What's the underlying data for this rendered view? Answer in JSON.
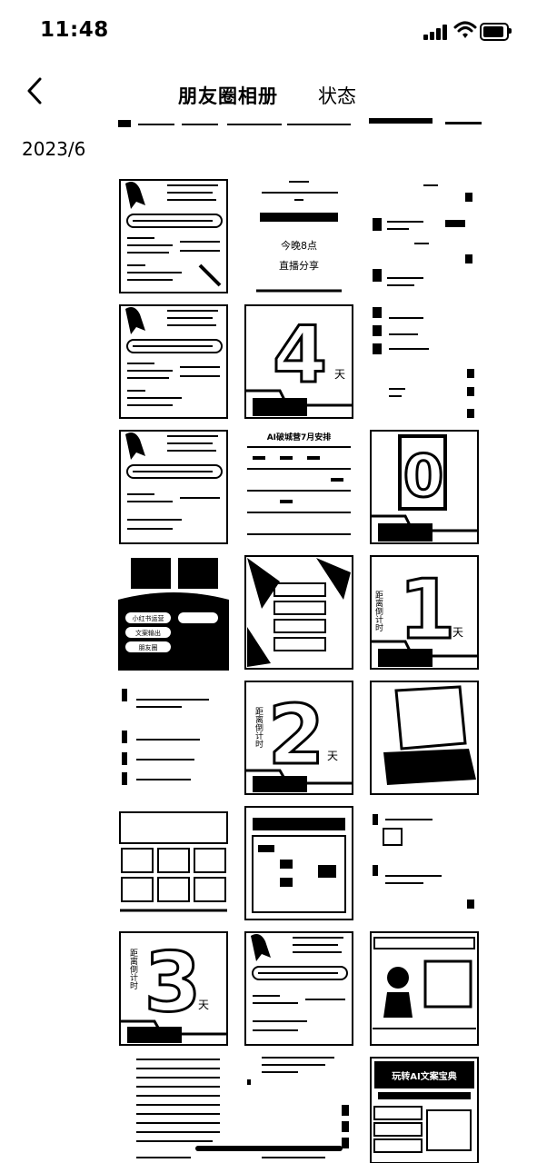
{
  "status_bar": {
    "time": "11:48"
  },
  "nav": {
    "album_tab": "朋友圈相册",
    "status_tab": "状态"
  },
  "section": {
    "month": "2023/6"
  },
  "photos": {
    "countdown_label": "距离倒计时",
    "day_unit": "天",
    "countdown_4": "4",
    "countdown_3": "3",
    "countdown_2": "2",
    "countdown_1": "1",
    "countdown_0": "0",
    "schedule_title": "AI破城营7月安排",
    "invite_line_1": "今晚8点",
    "invite_line_2": "直播分享",
    "tag_1": "小红书运营",
    "tag_2": "文案输出",
    "tag_3": "朋友圈",
    "promo_title": "玩转AI文案宝典"
  },
  "icons": {
    "back": "chevron-left-icon",
    "signal": "cellular-signal-icon",
    "wifi": "wifi-icon",
    "battery": "battery-icon"
  }
}
